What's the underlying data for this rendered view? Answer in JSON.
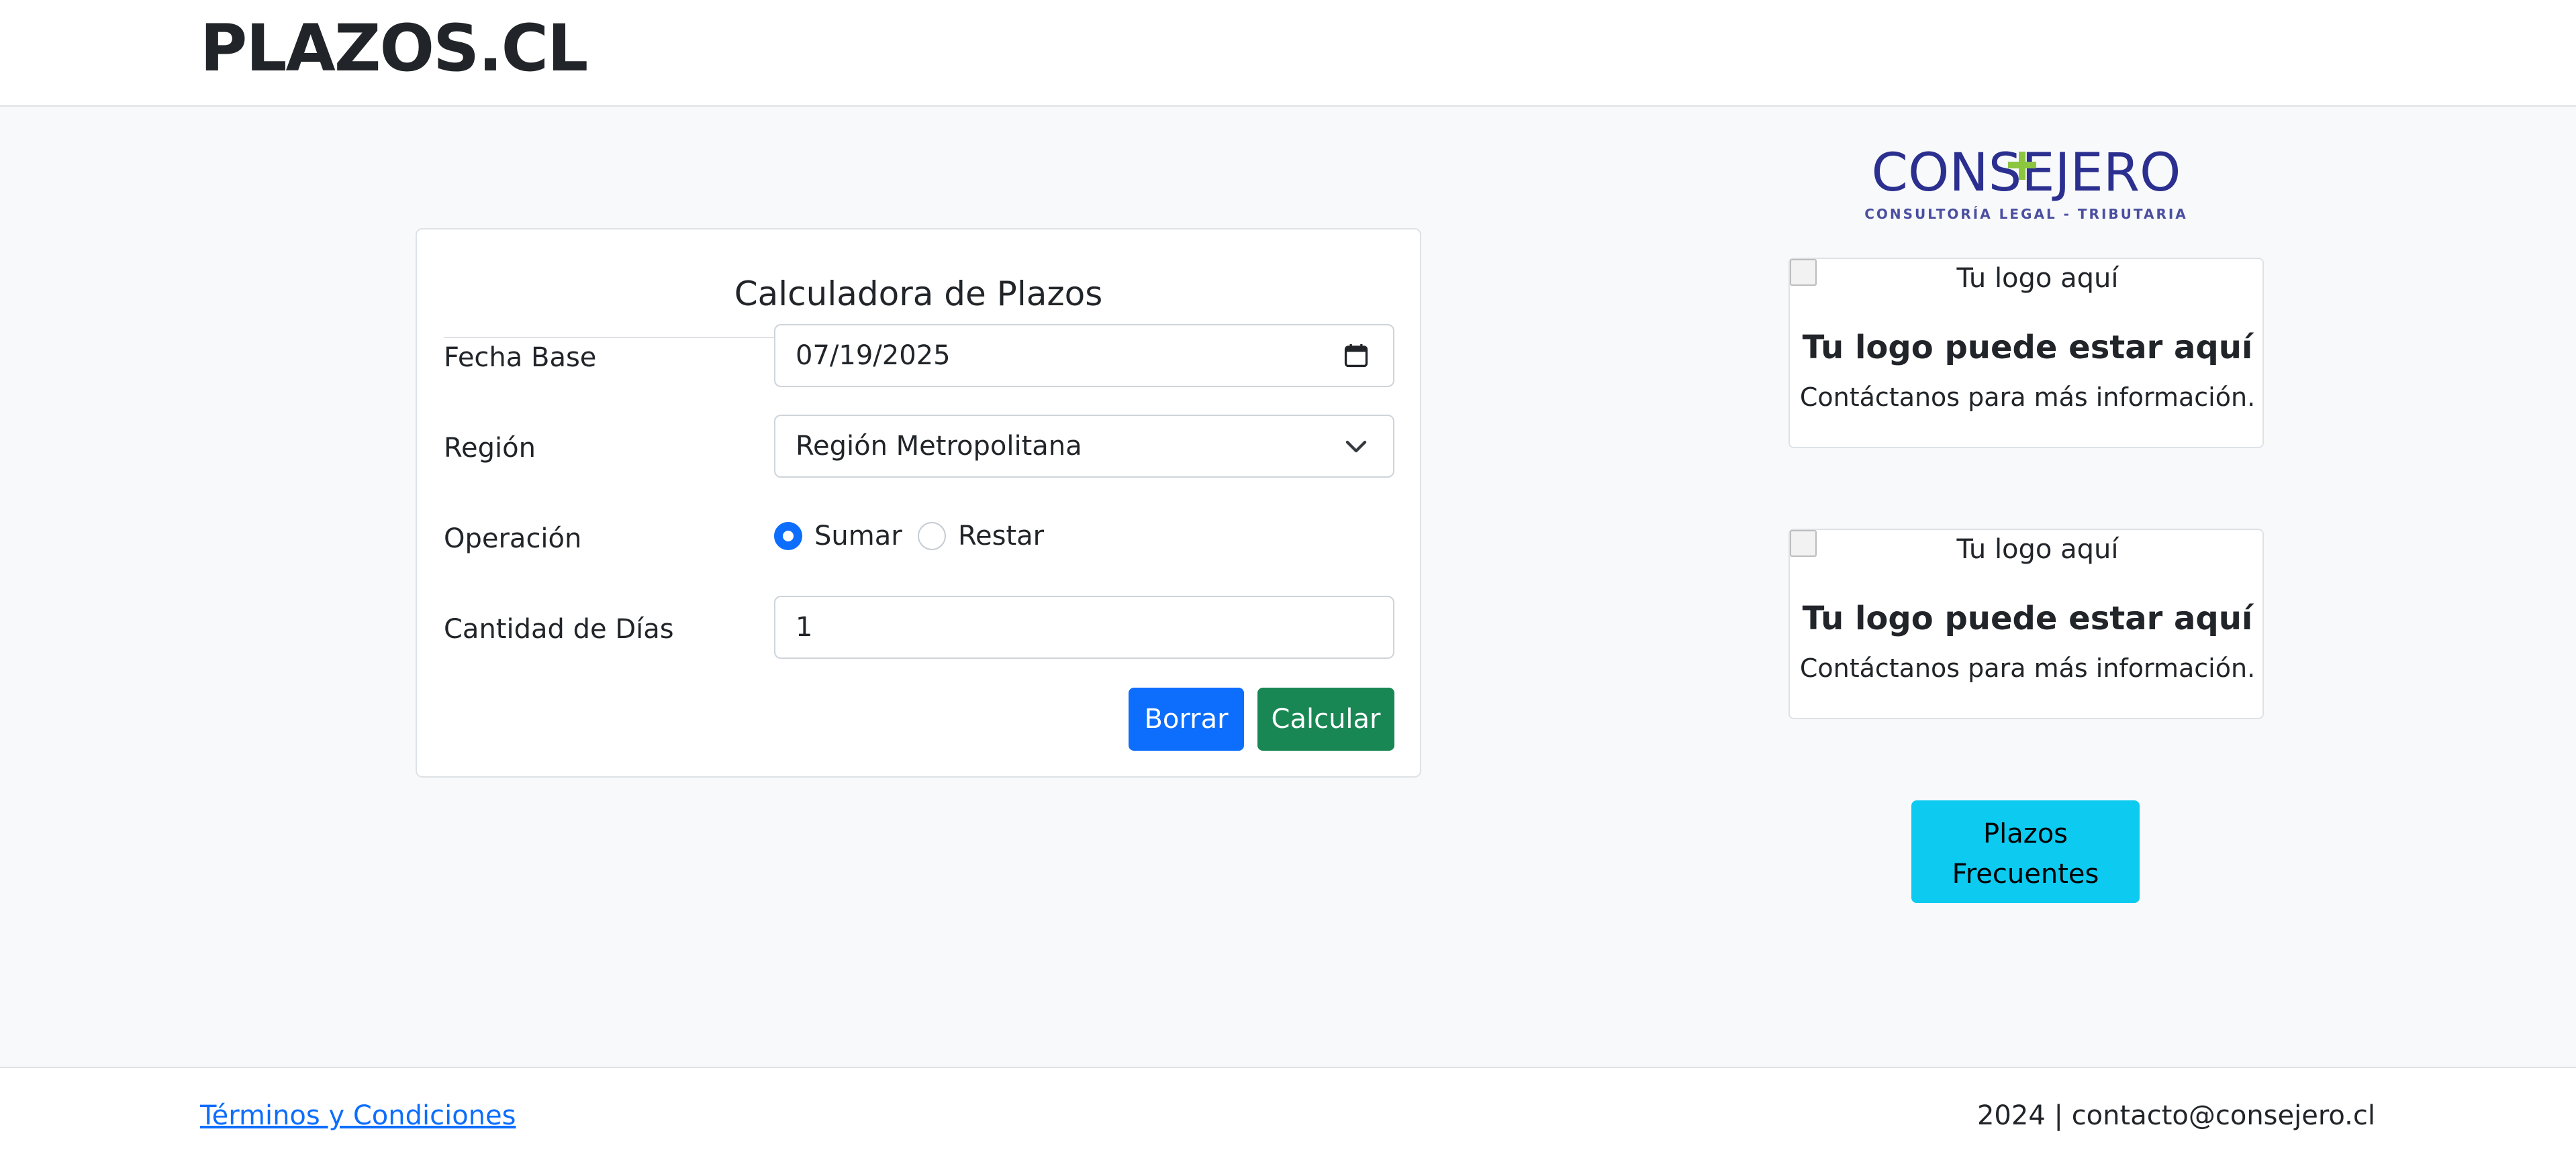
{
  "header": {
    "brand": "PLAZOS.CL"
  },
  "calculator": {
    "title": "Calculadora de Plazos",
    "fecha_base": {
      "label": "Fecha Base",
      "value": "07/19/2025",
      "icon": "calendar-icon"
    },
    "region": {
      "label": "Región",
      "value": "Región Metropolitana",
      "icon": "chevron-down-icon"
    },
    "operacion": {
      "label": "Operación",
      "options": [
        {
          "label": "Sumar",
          "checked": true
        },
        {
          "label": "Restar",
          "checked": false
        }
      ]
    },
    "cantidad_dias": {
      "label": "Cantidad de Días",
      "value": "1"
    },
    "buttons": {
      "borrar": "Borrar",
      "calcular": "Calcular"
    }
  },
  "sidebar": {
    "logo": {
      "name": "CONSEJERO",
      "tagline": "CONSULTORÍA LEGAL - TRIBUTARIA",
      "colors": {
        "text": "#2b2f8f",
        "accent": "#8cc63f"
      }
    },
    "ads": [
      {
        "alt": "Tu logo aquí",
        "title": "Tu logo puede estar aquí",
        "text": "Contáctanos para más información."
      },
      {
        "alt": "Tu logo aquí",
        "title": "Tu logo puede estar aquí",
        "text": "Contáctanos para más información."
      }
    ],
    "frecuentes_button": {
      "line1": "Plazos",
      "line2": "Frecuentes"
    }
  },
  "footer": {
    "terms_link": "Términos y Condiciones",
    "copyright": "2024 | contacto@consejero.cl"
  },
  "colors": {
    "primary": "#0d6efd",
    "success": "#198754",
    "info": "#0dcaf0",
    "background": "#f8f9fa"
  }
}
